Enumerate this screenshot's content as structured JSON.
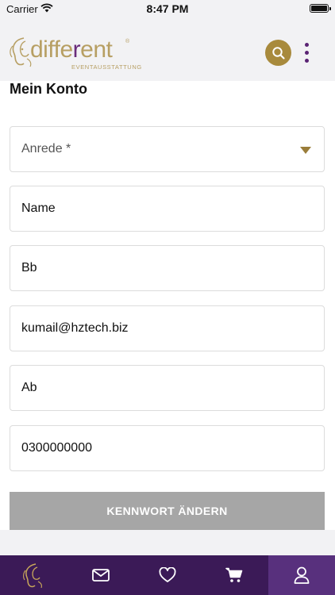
{
  "status_bar": {
    "carrier": "Carrier",
    "time": "8:47 PM"
  },
  "header": {
    "logo": {
      "prefix": "diffe",
      "highlight": "r",
      "suffix": "ent",
      "reg": "®",
      "tagline": "EVENTAUSSTATTUNG"
    },
    "search_icon": "search-icon",
    "menu_icon": "more-vertical-icon",
    "accent_color": "#a88a3c",
    "brand_purple": "#5a2373"
  },
  "page": {
    "title": "Mein Konto"
  },
  "form": {
    "salutation": {
      "placeholder": "Anrede *"
    },
    "name": "Name",
    "field2": "Bb",
    "email": "kumail@hztech.biz",
    "field4": "Ab",
    "phone": "0300000000"
  },
  "change_password_label": "KENNWORT ÄNDERN",
  "tab_bar": {
    "background": "#3b1a57",
    "active_background": "#58307d",
    "items": [
      {
        "icon": "logo-icon",
        "active": false
      },
      {
        "icon": "mail-icon",
        "active": false
      },
      {
        "icon": "heart-icon",
        "active": false
      },
      {
        "icon": "cart-icon",
        "active": false
      },
      {
        "icon": "user-icon",
        "active": true
      }
    ]
  }
}
